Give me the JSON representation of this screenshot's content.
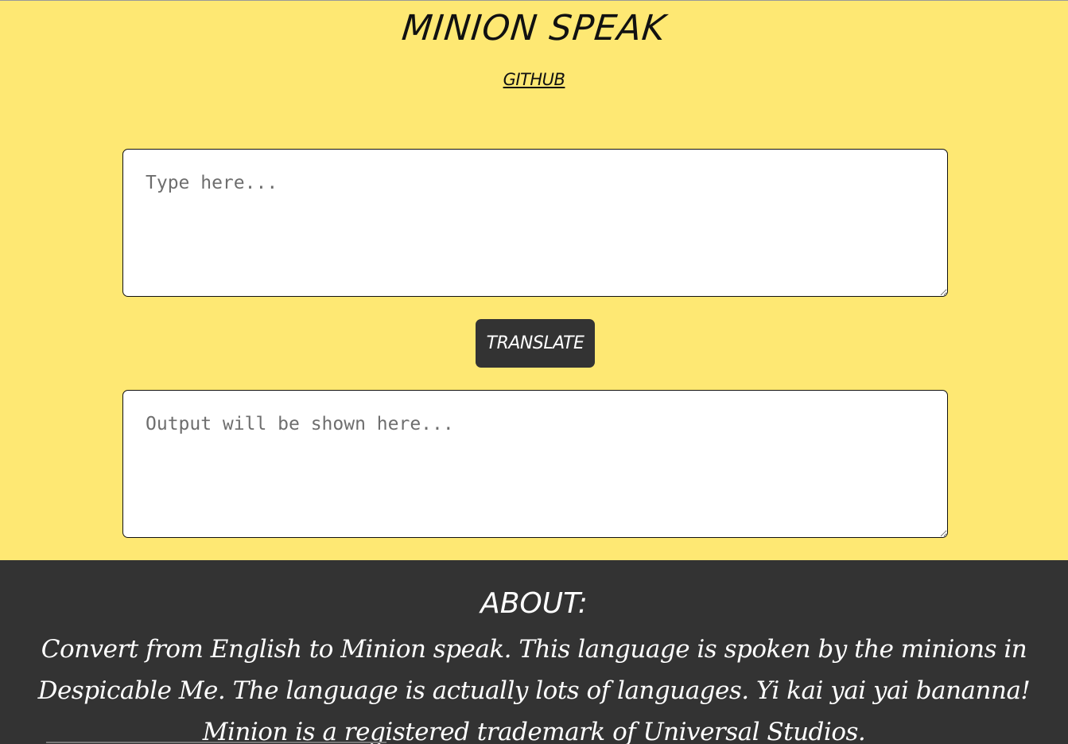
{
  "header": {
    "title": "MINION SPEAK",
    "github_link": "GITHUB"
  },
  "translator": {
    "input_placeholder": "Type here...",
    "input_value": "",
    "translate_label": "TRANSLATE",
    "output_placeholder": "Output will be shown here...",
    "output_value": ""
  },
  "about": {
    "heading": "ABOUT:",
    "text": "Convert from English to Minion speak. This language is spoken by the minions in Despicable Me. The language is actually lots of languages. Yi kai yai yai bananna! Minion is a registered trademark of Universal Studios."
  },
  "colors": {
    "background": "#fee873",
    "footer": "#333333",
    "button": "#333333",
    "text_dark": "#111111",
    "text_light": "#ffffff"
  }
}
